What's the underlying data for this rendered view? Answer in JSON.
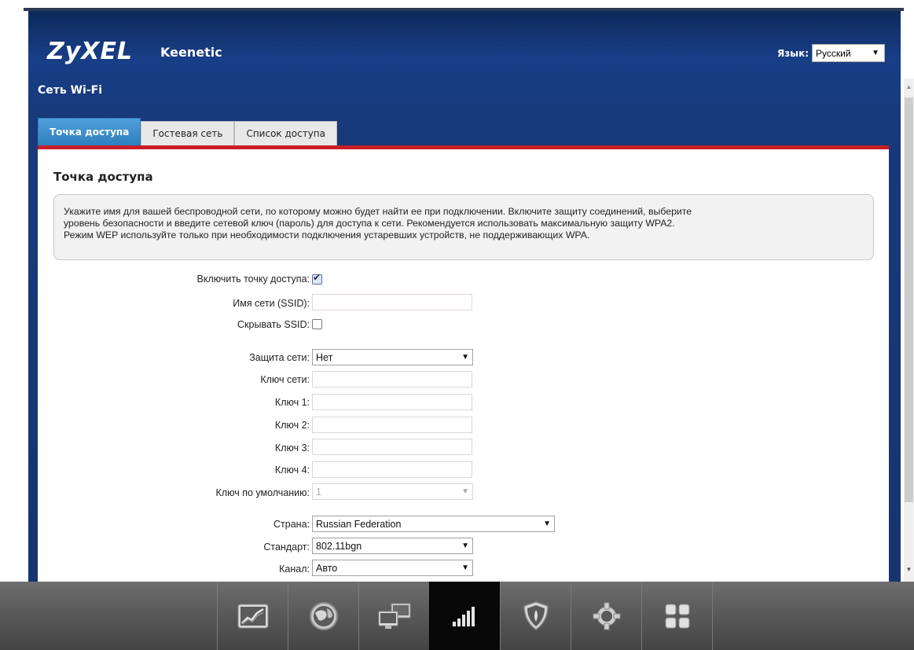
{
  "brand": {
    "logo": "ZyXEL",
    "product": "Keenetic"
  },
  "language": {
    "label": "Язык:",
    "value": "Русский"
  },
  "section_title": "Сеть Wi-Fi",
  "tabs": [
    {
      "label": "Точка доступа",
      "active": true
    },
    {
      "label": "Гостевая сеть",
      "active": false
    },
    {
      "label": "Список доступа",
      "active": false
    }
  ],
  "panel": {
    "title": "Точка доступа",
    "info_lines": [
      "Укажите имя для вашей беспроводной сети, по которому можно будет найти ее при подключении. Включите защиту соединений, выберите",
      "уровень безопасности и введите сетевой ключ (пароль) для доступа к сети. Рекомендуется использовать максимальную защиту WPA2.",
      "Режим WEP используйте только при необходимости подключения устаревших устройств, не поддерживающих WPA."
    ]
  },
  "form": {
    "enable_ap": {
      "label": "Включить точку доступа:",
      "checked": true
    },
    "ssid": {
      "label": "Имя сети (SSID):",
      "value": ""
    },
    "hide_ssid": {
      "label": "Скрывать SSID:",
      "checked": false
    },
    "security": {
      "label": "Защита сети:",
      "value": "Нет"
    },
    "network_key": {
      "label": "Ключ сети:",
      "value": ""
    },
    "key1": {
      "label": "Ключ 1:",
      "value": ""
    },
    "key2": {
      "label": "Ключ 2:",
      "value": ""
    },
    "key3": {
      "label": "Ключ 3:",
      "value": ""
    },
    "key4": {
      "label": "Ключ 4:",
      "value": ""
    },
    "default_key": {
      "label": "Ключ по умолчанию:",
      "value": "1",
      "disabled": true
    },
    "country": {
      "label": "Страна:",
      "value": "Russian Federation"
    },
    "standard": {
      "label": "Стандарт:",
      "value": "802.11bgn"
    },
    "channel": {
      "label": "Канал:",
      "value": "Авто"
    }
  },
  "dock": [
    {
      "icon": "monitor-chart-icon"
    },
    {
      "icon": "globe-icon"
    },
    {
      "icon": "computers-network-icon"
    },
    {
      "icon": "wifi-signal-bars-icon",
      "active": true
    },
    {
      "icon": "shield-icon"
    },
    {
      "icon": "gear-icon"
    },
    {
      "icon": "apps-grid-icon"
    }
  ],
  "colors": {
    "header_blue": "#183e86",
    "tab_active": "#2e7fbe",
    "accent_red": "#c81e28",
    "dock_gray": "#5c5c5c"
  }
}
